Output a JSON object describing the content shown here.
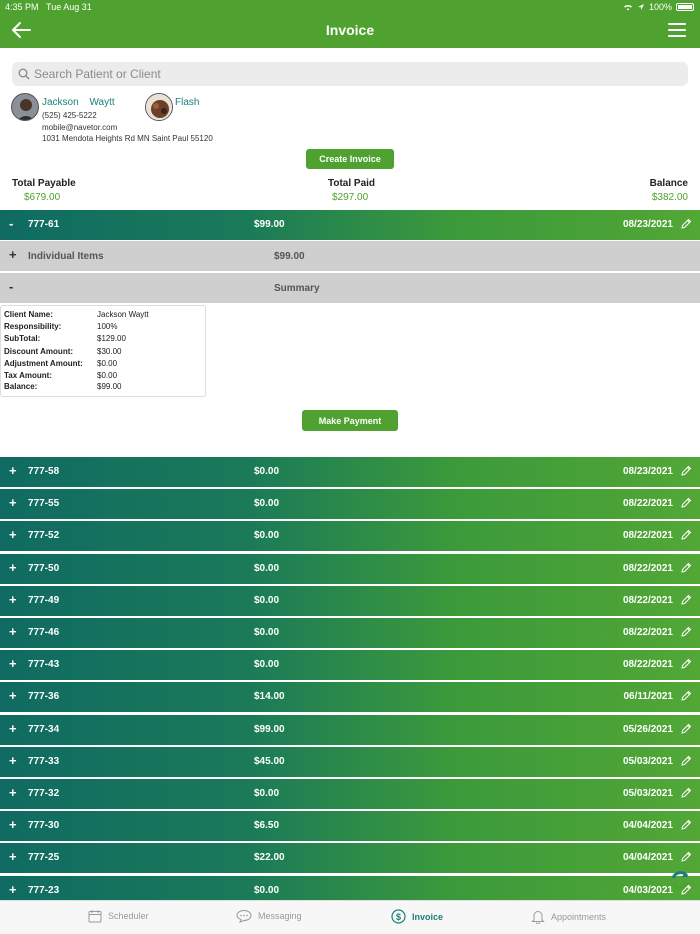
{
  "status": {
    "time": "4:35 PM",
    "date": "Tue Aug 31",
    "battery": "100%"
  },
  "nav": {
    "title": "Invoice"
  },
  "search": {
    "placeholder": "Search Patient or Client"
  },
  "client": {
    "name": "Jackson   Waytt",
    "phone": "(525) 425-5222",
    "email": "mobile@navetor.com",
    "address": "1031 Mendota Heights Rd MN Saint Paul 55120",
    "pet": "Flash"
  },
  "actions": {
    "create_invoice": "Create Invoice",
    "make_payment": "Make Payment"
  },
  "totals": {
    "payable_label": "Total Payable",
    "payable": "$679.00",
    "paid_label": "Total Paid",
    "paid": "$297.00",
    "balance_label": "Balance",
    "balance": "$382.00"
  },
  "expanded": {
    "number": "777-61",
    "amount": "$99.00",
    "date": "08/23/2021",
    "toggle": "-",
    "items": {
      "toggle": "+",
      "label": "Individual Items",
      "amount": "$99.00"
    },
    "summary": {
      "toggle": "-",
      "label": "Summary"
    },
    "summary_details": [
      {
        "k": "Client Name:",
        "v": "Jackson Waytt"
      },
      {
        "k": "Responsibility:",
        "v": "100%"
      },
      {
        "k": "SubTotal:",
        "v": "$129.00"
      },
      {
        "k": "Discount Amount:",
        "v": "$30.00"
      },
      {
        "k": "Adjustment Amount:",
        "v": "$0.00"
      },
      {
        "k": "Tax Amount:",
        "v": "$0.00"
      },
      {
        "k": "Balance:",
        "v": "$99.00"
      }
    ]
  },
  "invoices": [
    {
      "toggle": "+",
      "number": "777-58",
      "amount": "$0.00",
      "date": "08/23/2021"
    },
    {
      "toggle": "+",
      "number": "777-55",
      "amount": "$0.00",
      "date": "08/22/2021"
    },
    {
      "toggle": "+",
      "number": "777-52",
      "amount": "$0.00",
      "date": "08/22/2021"
    },
    {
      "toggle": "+",
      "number": "777-50",
      "amount": "$0.00",
      "date": "08/22/2021"
    },
    {
      "toggle": "+",
      "number": "777-49",
      "amount": "$0.00",
      "date": "08/22/2021"
    },
    {
      "toggle": "+",
      "number": "777-46",
      "amount": "$0.00",
      "date": "08/22/2021"
    },
    {
      "toggle": "+",
      "number": "777-43",
      "amount": "$0.00",
      "date": "08/22/2021"
    },
    {
      "toggle": "+",
      "number": "777-36",
      "amount": "$14.00",
      "date": "06/11/2021"
    },
    {
      "toggle": "+",
      "number": "777-34",
      "amount": "$99.00",
      "date": "05/26/2021"
    },
    {
      "toggle": "+",
      "number": "777-33",
      "amount": "$45.00",
      "date": "05/03/2021"
    },
    {
      "toggle": "+",
      "number": "777-32",
      "amount": "$0.00",
      "date": "05/03/2021"
    },
    {
      "toggle": "+",
      "number": "777-30",
      "amount": "$6.50",
      "date": "04/04/2021"
    },
    {
      "toggle": "+",
      "number": "777-25",
      "amount": "$22.00",
      "date": "04/04/2021"
    },
    {
      "toggle": "+",
      "number": "777-23",
      "amount": "$0.00",
      "date": "04/03/2021"
    }
  ],
  "tabs": [
    {
      "label": "Scheduler",
      "icon": "calendar-icon",
      "active": false
    },
    {
      "label": "Messaging",
      "icon": "chat-bubble-icon",
      "active": false
    },
    {
      "label": "Invoice",
      "icon": "dollar-icon",
      "active": true
    },
    {
      "label": "Appointments",
      "icon": "bell-icon",
      "active": false
    }
  ],
  "colors": {
    "brand_green": "#4fa22f",
    "teal": "#0f6b62",
    "link_teal": "#1c7f7a"
  }
}
